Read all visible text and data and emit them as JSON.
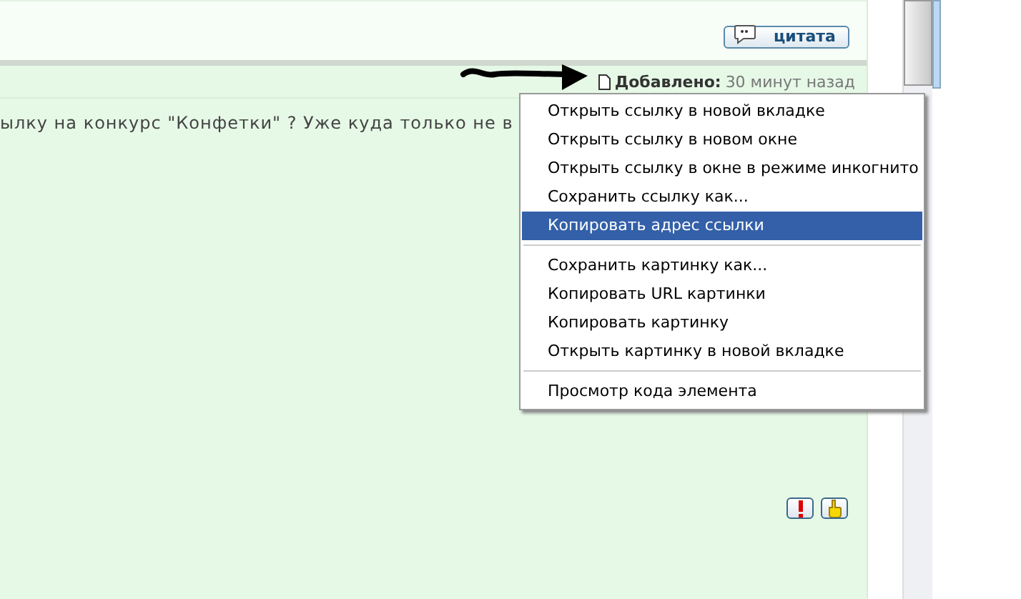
{
  "quote_button": {
    "label": "цитата"
  },
  "post": {
    "added_label": "Добавлено:",
    "added_time": "30 минут назад",
    "text": "ылку на конкурс \"Конфетки\" ? Уже куда только не в"
  },
  "context_menu": {
    "groups": [
      [
        {
          "label": "Открыть ссылку в новой вкладке",
          "selected": false
        },
        {
          "label": "Открыть ссылку в новом окне",
          "selected": false
        },
        {
          "label": "Открыть ссылку в окне в режиме инкогнито",
          "selected": false
        },
        {
          "label": "Сохранить ссылку как...",
          "selected": false
        },
        {
          "label": "Копировать адрес ссылки",
          "selected": true
        }
      ],
      [
        {
          "label": "Сохранить картинку как...",
          "selected": false
        },
        {
          "label": "Копировать URL картинки",
          "selected": false
        },
        {
          "label": "Копировать картинку",
          "selected": false
        },
        {
          "label": "Открыть картинку в новой вкладке",
          "selected": false
        }
      ],
      [
        {
          "label": "Просмотр кода элемента",
          "selected": false
        }
      ]
    ]
  }
}
